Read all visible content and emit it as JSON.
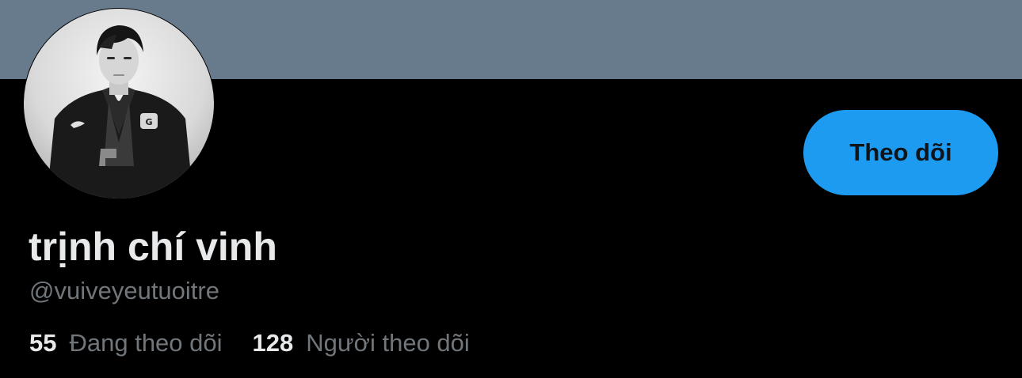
{
  "profile": {
    "display_name": "trịnh chí vinh",
    "handle": "@vuiveyeutuoitre",
    "follow_button_label": "Theo dõi",
    "avatar_alt": "trịnh chí vinh",
    "stats": {
      "following_count": "55",
      "following_label": "Đang theo dõi",
      "followers_count": "128",
      "followers_label": "Người theo dõi"
    }
  },
  "colors": {
    "banner": "#687b8c",
    "background": "#000000",
    "accent": "#1d9bf0",
    "primary_text": "#e7e9ea",
    "secondary_text": "#71767b"
  }
}
